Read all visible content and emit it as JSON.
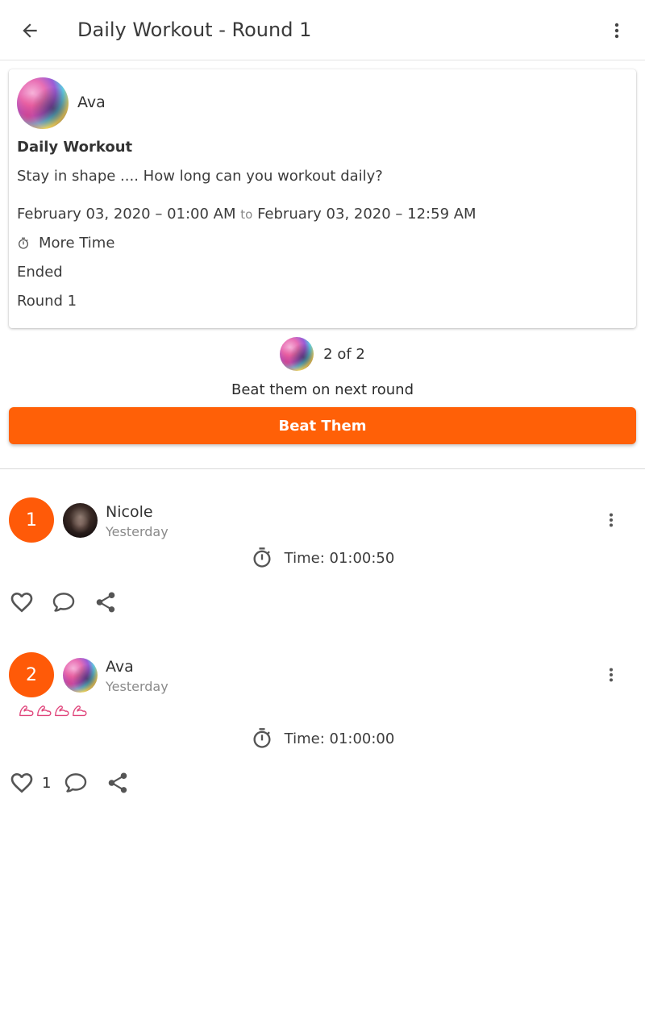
{
  "header": {
    "title": "Daily Workout - Round 1"
  },
  "challenge": {
    "owner_name": "Ava",
    "title": "Daily Workout",
    "description": "Stay in shape .... How long can you workout daily?",
    "start": "February 03, 2020 – 01:00 AM",
    "to_label": "to",
    "end": "February 03, 2020 – 12:59 AM",
    "type_label": "More Time",
    "status": "Ended",
    "round": "Round 1"
  },
  "rank_summary": {
    "text": "2 of 2"
  },
  "beat": {
    "caption": "Beat them on next round",
    "button_label": "Beat Them"
  },
  "entries": [
    {
      "rank": "1",
      "name": "Nicole",
      "when": "Yesterday",
      "time": "Time: 01:00:50",
      "likes": "",
      "badges": 0
    },
    {
      "rank": "2",
      "name": "Ava",
      "when": "Yesterday",
      "time": "Time: 01:00:00",
      "likes": "1",
      "badges": 4
    }
  ],
  "colors": {
    "accent": "#ff6007",
    "rank_circle": "#ff5a08",
    "badge": "#e0457b"
  }
}
